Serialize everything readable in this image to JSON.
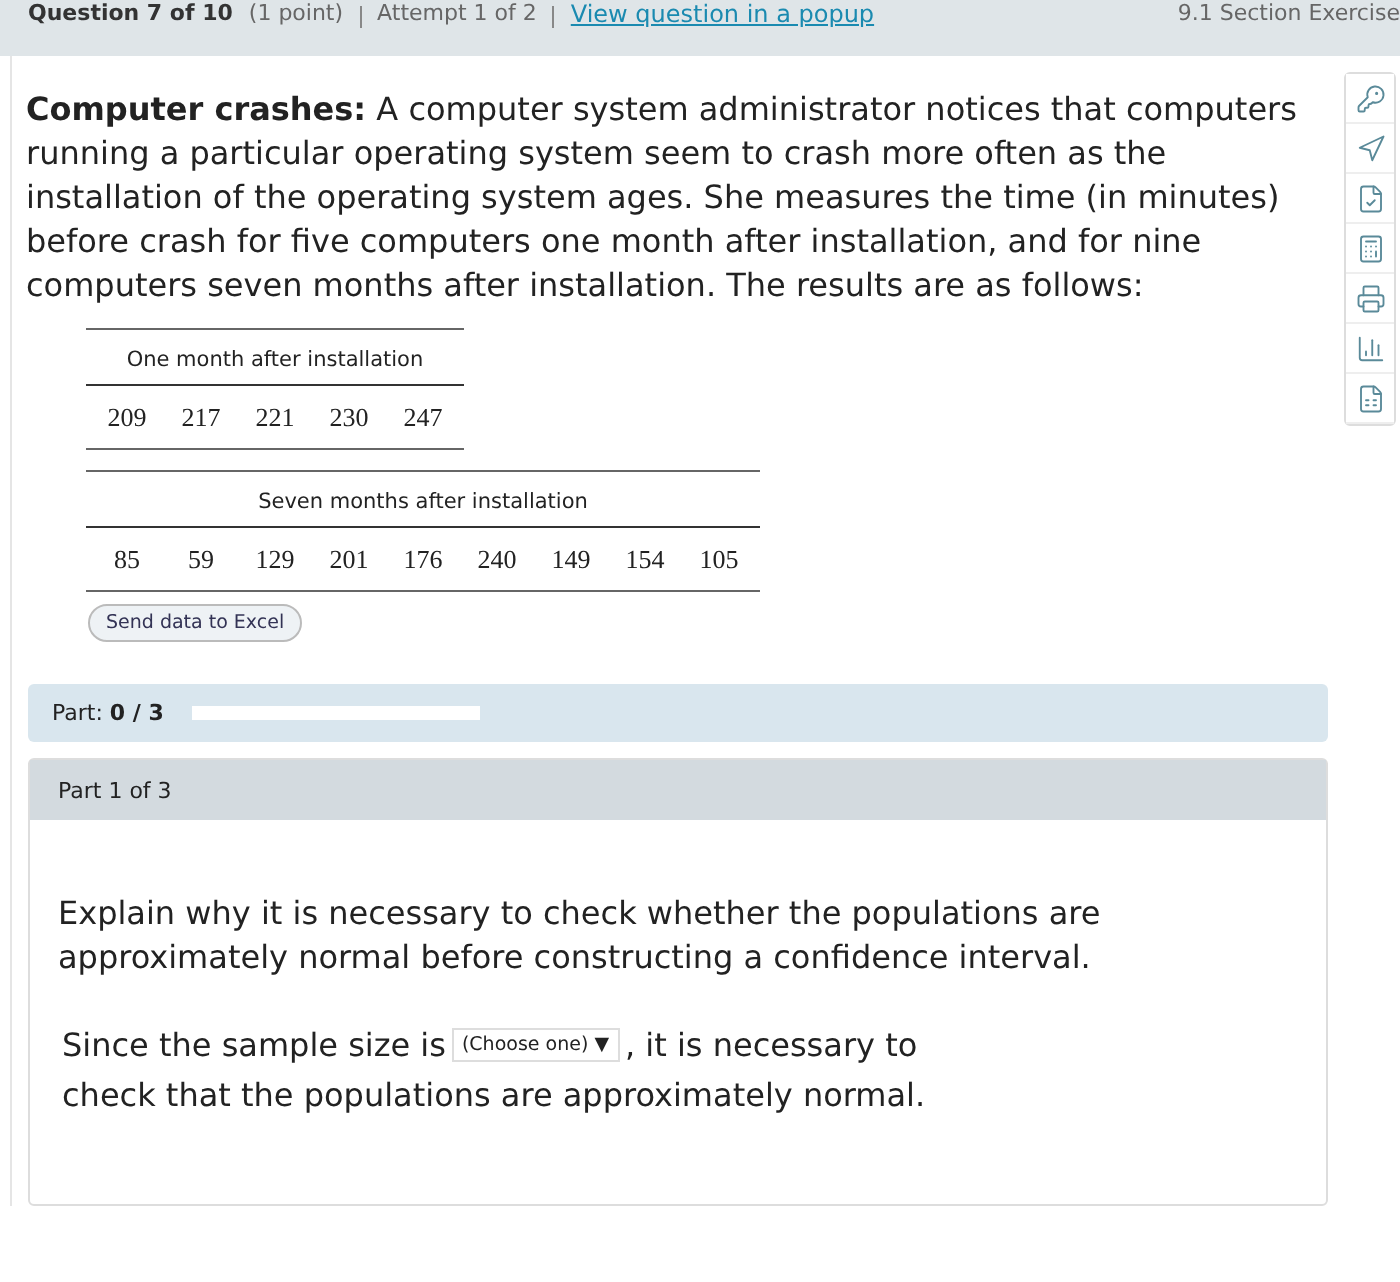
{
  "header": {
    "question": "Question 7 of 10",
    "points": "(1 point)",
    "attempt": "Attempt 1 of 2",
    "popup_link": "View question in a popup",
    "section": "9.1 Section Exercise"
  },
  "question": {
    "text": "**Computer crashes:** A computer system administrator notices that computers running a particular operating system seem to crash more often as the installation of the operating system ages. She measures the time (in minutes) before crash for five computers one month after installation, and for nine computers seven months after installation. The results are as follows:"
  },
  "tables": [
    {
      "title": "One month after installation",
      "values": [
        "209",
        "217",
        "221",
        "230",
        "247"
      ]
    },
    {
      "title": "Seven months after installation",
      "values": [
        "85",
        "59",
        "129",
        "201",
        "176",
        "240",
        "149",
        "154",
        "105"
      ]
    }
  ],
  "excel_button": "Send data to Excel",
  "progress": {
    "label": "Part: **0 / 3**",
    "level": 0
  },
  "part": {
    "title": "Part 1 of 3",
    "prompt": "Explain why it is necessary to check whether the populations are approximately normal before constructing a confidence interval.",
    "before": "Since the sample size is",
    "dropdown": "(Choose one)",
    "arrow": "▼",
    "after": ", it is necessary to",
    "continuation": "check that the populations are approximately normal."
  }
}
